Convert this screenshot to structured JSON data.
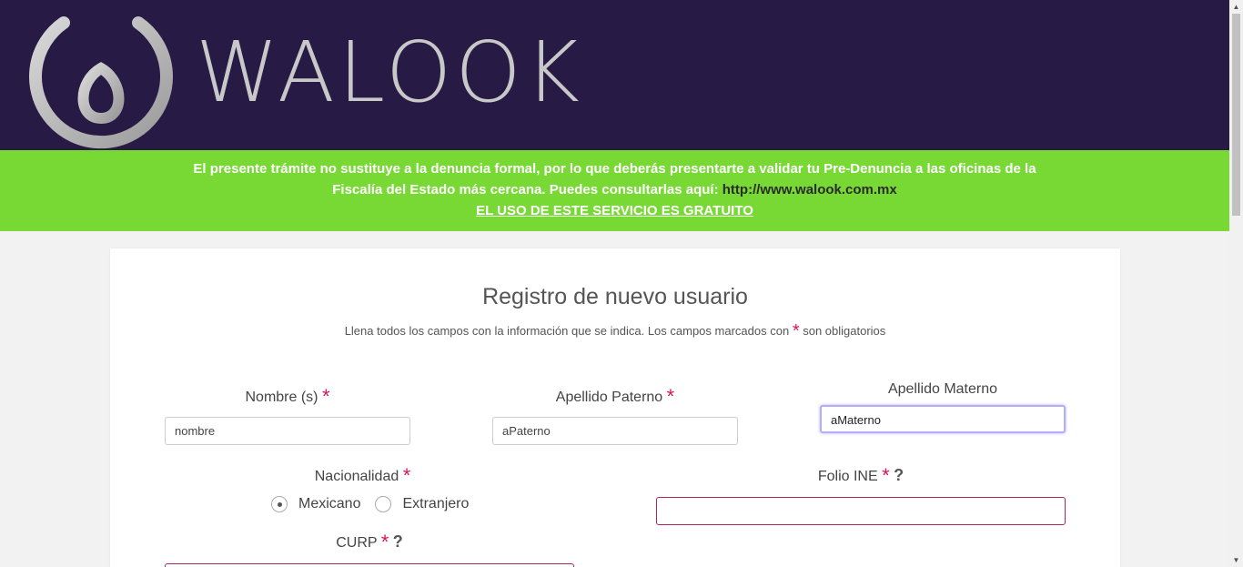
{
  "header": {
    "brand": "WALOOK",
    "bg_color": "#271a45"
  },
  "notice": {
    "line1": "El presente trámite no sustituye a la denuncia formal, por lo que deberás presentarte a validar tu Pre-Denuncia a las oficinas de la",
    "line2": "Fiscalía del Estado más cercana. Puedes consultarlas aquí:",
    "url": "http://www.walook.com.mx",
    "free": "EL USO DE ESTE SERVICIO ES GRATUITO",
    "bg_color": "#78d935"
  },
  "form": {
    "title": "Registro de nuevo usuario",
    "subtitle_before": "Llena todos los campos con la información que se indica. Los campos marcados con",
    "subtitle_after": "son obligatorios",
    "required_mark": "*",
    "help_mark": "?",
    "nombre": {
      "label": "Nombre (s)",
      "value": "nombre"
    },
    "paterno": {
      "label": "Apellido Paterno",
      "value": "aPaterno"
    },
    "materno": {
      "label": "Apellido Materno",
      "value": "aMaterno"
    },
    "nacionalidad": {
      "label": "Nacionalidad",
      "options": [
        "Mexicano",
        "Extranjero"
      ],
      "selected": "Mexicano"
    },
    "folio": {
      "label": "Folio INE",
      "value": ""
    },
    "curp": {
      "label": "CURP",
      "value": ""
    }
  },
  "colors": {
    "required": "#d4145a",
    "invalid_border": "#b0245a",
    "focus_border": "#b3aef5"
  }
}
